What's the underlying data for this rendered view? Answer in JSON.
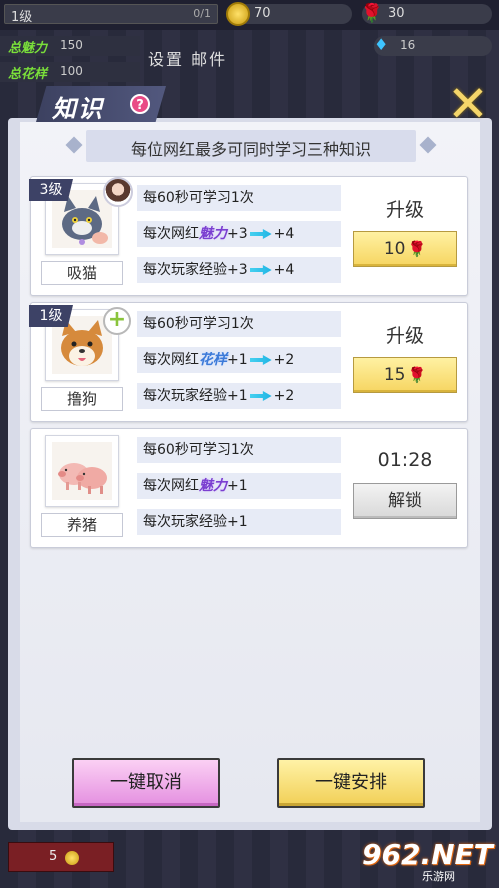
{
  "topbar": {
    "level": "1级",
    "level_progress": "0/1",
    "coins": "70",
    "roses": "30",
    "gems": "16",
    "charm_label": "总魅力",
    "charm_value": "150",
    "style_label": "总花样",
    "style_value": "100",
    "menu": "设置 邮件"
  },
  "dialog": {
    "title": "知识",
    "help": "?",
    "close": "✕",
    "notice": "每位网红最多可同时学习三种知识"
  },
  "cards": [
    {
      "level": "3级",
      "pet_name": "吸猫",
      "row1": "每60秒可学习1次",
      "row2_prefix": "每次网红",
      "row2_attr": "魅力",
      "row2_from": "+3",
      "row2_to": "+4",
      "row3_prefix": "每次玩家经验",
      "row3_from": "+3",
      "row3_to": "+4",
      "action_label": "升级",
      "button_label": "10"
    },
    {
      "level": "1级",
      "pet_name": "撸狗",
      "row1": "每60秒可学习1次",
      "row2_prefix": "每次网红",
      "row2_attr": "花样",
      "row2_from": "+1",
      "row2_to": "+2",
      "row3_prefix": "每次玩家经验",
      "row3_from": "+1",
      "row3_to": "+2",
      "action_label": "升级",
      "button_label": "15"
    },
    {
      "pet_name": "养猪",
      "row1": "每60秒可学习1次",
      "row2_prefix": "每次网红",
      "row2_attr": "魅力",
      "row2_from": "+1",
      "row3_prefix": "每次玩家经验",
      "row3_from": "+1",
      "timer": "01:28",
      "button_label": "解锁"
    }
  ],
  "footer": {
    "cancel_all": "一键取消",
    "arrange_all": "一键安排",
    "bottom_value": "5"
  },
  "watermark": {
    "main": "962.NET",
    "sub": "乐游网"
  },
  "colors": {
    "dialog_bg": "#f2f3f8",
    "title_ribbon": "#3c4160",
    "yellow_button": "#f6d561",
    "pink_button": "#e48fe0",
    "charm_attr": "#7b3fd0",
    "style_attr": "#3c7ad8",
    "arrow": "#45d0f0",
    "rose": "#d72030"
  }
}
